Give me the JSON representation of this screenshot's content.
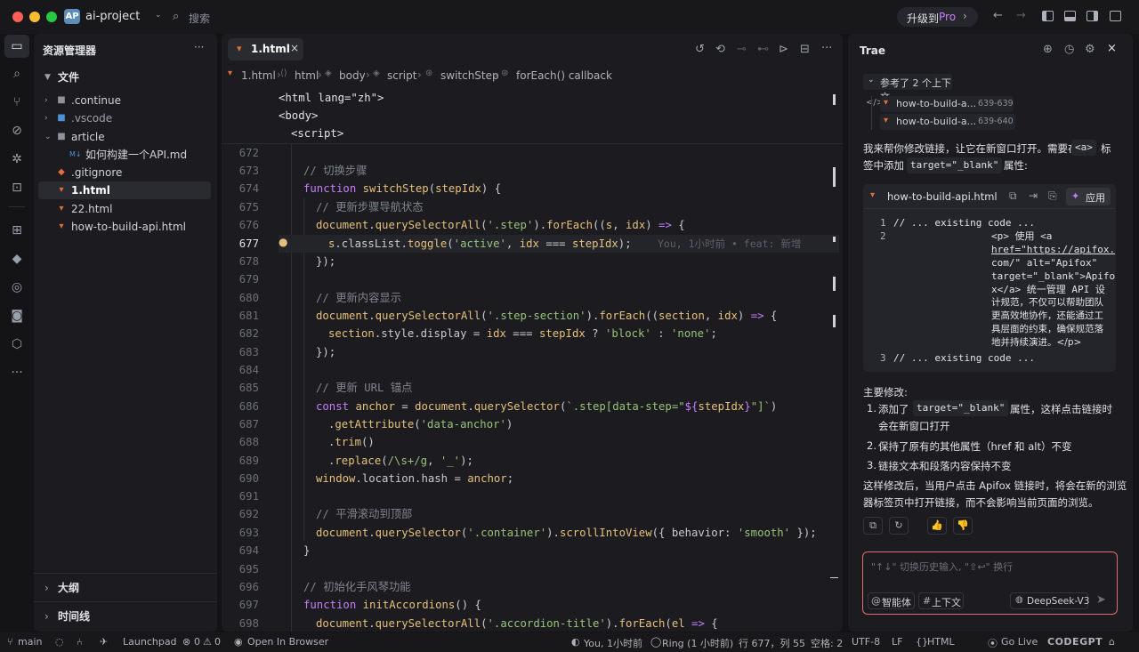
{
  "titlebar": {
    "project_badge": "AP",
    "project_name": "ai-project",
    "search_label": "搜索",
    "upgrade_label": "升级到",
    "upgrade_pro": "Pro"
  },
  "explorer": {
    "title": "资源管理器",
    "more": "···",
    "files_section": "文件",
    "items": [
      {
        "label": ".continue"
      },
      {
        "label": ".vscode"
      },
      {
        "label": "article"
      },
      {
        "label": "如何构建一个API.md"
      },
      {
        "label": ".gitignore"
      },
      {
        "label": "1.html"
      },
      {
        "label": "22.html"
      },
      {
        "label": "how-to-build-api.html"
      }
    ],
    "outline": "大纲",
    "timeline": "时间线"
  },
  "editor": {
    "tab_label": "1.html",
    "breadcrumb": [
      "1.html",
      "html",
      "body",
      "script",
      "switchStep",
      "forEach() callback"
    ],
    "sticky": [
      "<html lang=\"zh\">",
      "<body>",
      "<script>"
    ],
    "line_numbers": [
      "672",
      "673",
      "674",
      "675",
      "676",
      "677",
      "678",
      "679",
      "680",
      "681",
      "682",
      "683",
      "684",
      "685",
      "686",
      "687",
      "688",
      "689",
      "690",
      "691",
      "692",
      "693",
      "694",
      "695",
      "696",
      "697",
      "698"
    ],
    "blame": "You, 1小时前 • feat: 新增"
  },
  "chat": {
    "title": "Trae",
    "ref_label": "参考了 2 个上下文",
    "refs": [
      {
        "file": "how-to-build-a...",
        "range": "639-639"
      },
      {
        "file": "how-to-build-a...",
        "range": "639-640"
      }
    ],
    "intro_1": "我来帮你修改链接，让它在新窗口打开。需要在",
    "intro_tag": "<a>",
    "intro_2": "标签中添加",
    "intro_attr": "target=\"_blank\"",
    "intro_3": "属性:",
    "code_file": "how-to-build-api.html",
    "apply_label": "应用",
    "code_ln": [
      "1",
      "2",
      "3"
    ],
    "code_1": "// ... existing code ...",
    "code_2a": "<p> 使用 <a",
    "code_2b": "href=\"https://apifox.",
    "code_2c": "com/\" alt=\"Apifox\"",
    "code_2d": "target=\"_blank\">Apifo",
    "code_2e": "x</a> 统一管理 API 设",
    "code_2f": "计规范，不仅可以帮助团队",
    "code_2g": "更高效地协作，还能通过工",
    "code_2h": "具层面的约束，确保规范落",
    "code_2i": "地并持续演进。</p>",
    "code_3": "// ... existing code ...",
    "summary_title": "主要修改:",
    "bullet_1a": "添加了",
    "bullet_1_code": "target=\"_blank\"",
    "bullet_1b": "属性，这样点击链接时",
    "bullet_1c": "会在新窗口打开",
    "bullet_2": "保持了原有的其他属性（href 和 alt）不变",
    "bullet_3": "链接文本和段落内容保持不变",
    "num_1": "1.",
    "num_2": "2.",
    "num_3": "3.",
    "closing_1": "这样修改后，当用户点击 Apifox 链接时，将会在新的浏览",
    "closing_2": "器标签页中打开链接，而不会影响当前页面的浏览。",
    "input_placeholder": "\"↑↓\" 切换历史输入, \"⇧↩\" 换行",
    "agent_label": "智能体",
    "context_label": "上下文",
    "model_label": "DeepSeek-V3"
  },
  "status": {
    "branch": "main",
    "launchpad": "Launchpad",
    "errors": "0",
    "warnings": "0",
    "infos": "0",
    "open_browser": "Open In Browser",
    "blame": "You, 1小时前",
    "ring": "Ring (1 小时前)",
    "position": "行 677，列 55",
    "spaces": "空格: 2",
    "encoding": "UTF-8",
    "eol": "LF",
    "lang": "HTML",
    "golive": "Go Live",
    "codegpt": "CODEGPT"
  },
  "colors": {
    "accent": "#e26d6d",
    "pro": "#c77dff",
    "html_icon": "#e0703a"
  }
}
